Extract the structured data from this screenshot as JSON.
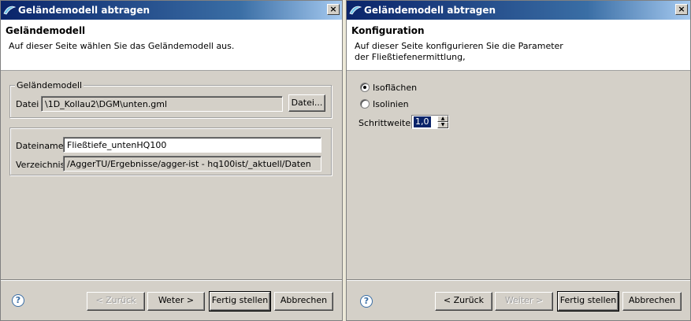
{
  "left": {
    "title": "Geländemodell abtragen",
    "close": "×",
    "banner": {
      "title": "Geländemodell",
      "desc": "Auf dieser Seite wählen Sie das Geländemodell aus."
    },
    "group1": {
      "legend": "Geländemodell",
      "datei_label": "Datei",
      "datei_value": "\\1D_Kollau2\\DGM\\unten.gml",
      "datei_button": "Datei..."
    },
    "group2": {
      "dateiname_label": "Dateiname",
      "dateiname_value": "Fließtiefe_untenHQ100",
      "verzeichnis_label": "Verzeichnis",
      "verzeichnis_value": "/AggerTU/Ergebnisse/agger-ist - hq100ist/_aktuell/Daten"
    },
    "buttons": {
      "back": "< Zurück",
      "next": "Weter >",
      "finish": "Fertig stellen",
      "cancel": "Abbrechen"
    },
    "help": "?"
  },
  "right": {
    "title": "Geländemodell abtragen",
    "close": "×",
    "banner": {
      "title": "Konfiguration",
      "desc": "Auf dieser Seite konfigurieren Sie die Parameter der Fließtiefenermittlung,"
    },
    "options": {
      "isoflaechen": "Isoflächen",
      "isolinien": "Isolinien",
      "selected": "Isoflächen"
    },
    "schrittweite_label": "Schrittweite:",
    "schrittweite_value": "1,0",
    "buttons": {
      "back": "< Zurück",
      "next": "Weiter >",
      "finish": "Fertig stellen",
      "cancel": "Abbrechen"
    },
    "help": "?"
  }
}
